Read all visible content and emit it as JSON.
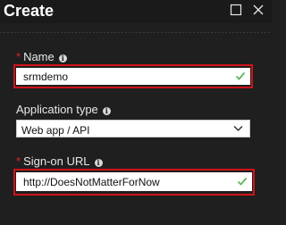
{
  "header": {
    "title": "Create"
  },
  "fields": {
    "name": {
      "required_mark": "*",
      "label": "Name",
      "value": "srmdemo"
    },
    "application_type": {
      "label": "Application type",
      "selected": "Web app / API",
      "options": [
        "Web app / API"
      ]
    },
    "sign_on_url": {
      "required_mark": "*",
      "label": "Sign-on URL",
      "value": "http://DoesNotMatterForNow"
    }
  },
  "icons": {
    "info": "i",
    "valid": "checkmark-icon",
    "dropdown": "chevron-down-icon",
    "maximize": "maximize-icon",
    "close": "close-icon"
  },
  "colors": {
    "highlight": "#d0121a",
    "valid_check": "#5cb85c",
    "required_star": "#e02020",
    "background": "#1f1f1f"
  }
}
